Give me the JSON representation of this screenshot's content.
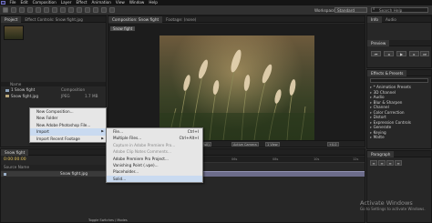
{
  "menubar": {
    "items": [
      "File",
      "Edit",
      "Composition",
      "Layer",
      "Effect",
      "Animation",
      "View",
      "Window",
      "Help"
    ]
  },
  "toolbar": {
    "workspace_label": "Workspace:",
    "workspace_value": "Standard",
    "search_placeholder": "Search Help"
  },
  "project_panel": {
    "tabs": [
      "Project",
      "Effect Controls: Snow fight.jpg"
    ],
    "items": [
      {
        "name": "1 Snow fight",
        "type": "Composition",
        "size": ""
      },
      {
        "name": "Snow fight.jpg",
        "type": "JPEG",
        "size": "1.7 MB"
      }
    ]
  },
  "composition_panel": {
    "tabs": [
      "Composition: Snow fight",
      "Footage: (none)"
    ],
    "comp_tag": "Snow fight",
    "viewer_controls": [
      "(Full)",
      "Active Camera",
      "1 View",
      "+0.0"
    ]
  },
  "right_panel": {
    "tabs": [
      "Info",
      "Audio"
    ],
    "preview_tab": "Preview"
  },
  "effects_panel": {
    "tab": "Effects & Presets",
    "items": [
      "* Animation Presets",
      "3D Channel",
      "Audio",
      "Blur & Sharpen",
      "Channel",
      "Color Correction",
      "Distort",
      "Expression Controls",
      "Generate",
      "Keying",
      "Matte"
    ]
  },
  "paragraph_panel": {
    "tab": "Paragraph"
  },
  "timeline": {
    "tab": "Snow fight",
    "timecode": "0:00:00:00",
    "layer_header": "Source Name",
    "layer_name": "Snow fight.jpg",
    "ticks": [
      "0s",
      "02s",
      "04s",
      "06s",
      "08s",
      "10s",
      "12s"
    ],
    "toggle_label": "Toggle Switches / Modes"
  },
  "context_menu": {
    "items": [
      "New Composition...",
      "New Folder",
      "New Adobe Photoshop File...",
      "Import",
      "Import Recent Footage"
    ],
    "highlighted": "Import"
  },
  "import_submenu": {
    "items": [
      {
        "label": "File...",
        "shortcut": "Ctrl+I",
        "enabled": true
      },
      {
        "label": "Multiple Files...",
        "shortcut": "Ctrl+Alt+I",
        "enabled": true
      },
      {
        "label": "Capture in Adobe Premiere Pro...",
        "shortcut": "",
        "enabled": false
      },
      {
        "label": "Adobe Clip Notes Comments...",
        "shortcut": "",
        "enabled": false
      },
      {
        "label": "Adobe Premiere Pro Project...",
        "shortcut": "",
        "enabled": true
      },
      {
        "label": "Vanishing Point (.vpe)...",
        "shortcut": "",
        "enabled": true
      },
      {
        "label": "Placeholder...",
        "shortcut": "",
        "enabled": true
      },
      {
        "label": "Solid...",
        "shortcut": "",
        "enabled": true
      }
    ],
    "highlighted": "Solid..."
  },
  "watermark": {
    "title": "Activate Windows",
    "subtitle": "Go to Settings to activate Windows."
  }
}
